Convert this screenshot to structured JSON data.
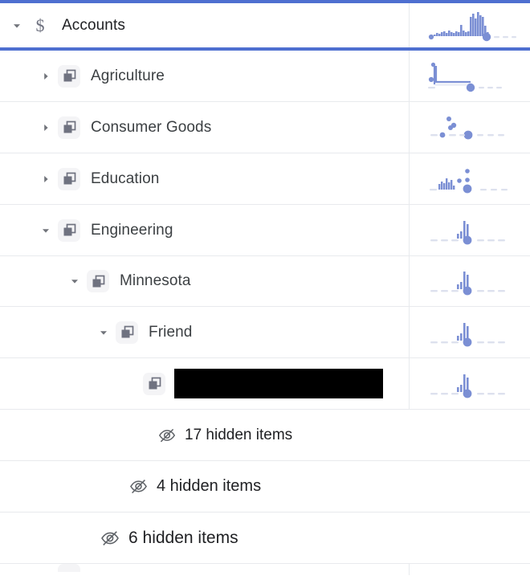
{
  "theme": {
    "accent_blue": "#4e6fd0",
    "spark_blue": "#7b8fd4",
    "spark_muted": "#dde1ee",
    "divider": "#e8eaed",
    "chip_bg": "#f4f4f6",
    "icon_gray": "#6f7280",
    "text": "#3c4043",
    "redaction": "#000000"
  },
  "header": {
    "title": "Accounts",
    "icon": "dollar-sign-icon",
    "twisty": "chevron-down-icon",
    "expanded": true
  },
  "rows": [
    {
      "label": "Agriculture",
      "icon": "layers-icon",
      "twisty": "chevron-right-icon",
      "expanded": false,
      "depth": 1,
      "type": "node"
    },
    {
      "label": "Consumer Goods",
      "icon": "layers-icon",
      "twisty": "chevron-right-icon",
      "expanded": false,
      "depth": 1,
      "type": "node"
    },
    {
      "label": "Education",
      "icon": "layers-icon",
      "twisty": "chevron-right-icon",
      "expanded": false,
      "depth": 1,
      "type": "node"
    },
    {
      "label": "Engineering",
      "icon": "layers-icon",
      "twisty": "chevron-down-icon",
      "expanded": true,
      "depth": 1,
      "type": "node"
    },
    {
      "label": "Minnesota",
      "icon": "layers-icon",
      "twisty": "chevron-down-icon",
      "expanded": true,
      "depth": 2,
      "type": "node"
    },
    {
      "label": "Friend",
      "icon": "layers-icon",
      "twisty": "chevron-down-icon",
      "expanded": true,
      "depth": 3,
      "type": "node"
    },
    {
      "label": "",
      "icon": "layers-icon",
      "twisty": "none",
      "expanded": false,
      "depth": 4,
      "type": "redacted"
    }
  ],
  "hidden_rows": [
    {
      "count": "17",
      "label": "17 hidden items",
      "icon": "eye-off-icon",
      "font_size": 19,
      "indent": 196
    },
    {
      "count": "4",
      "label": "4 hidden items",
      "icon": "eye-off-icon",
      "font_size": 20,
      "indent": 160
    },
    {
      "count": "6",
      "label": "6 hidden items",
      "icon": "eye-off-icon",
      "font_size": 21,
      "indent": 124
    }
  ],
  "chart_data": [
    {
      "type": "bar",
      "name": "Accounts",
      "title": "",
      "xlabel": "",
      "ylabel": "",
      "categories": [
        "1",
        "2",
        "3",
        "4",
        "5",
        "6",
        "7",
        "8",
        "9",
        "10",
        "11",
        "12",
        "13",
        "14",
        "15",
        "16",
        "17",
        "18",
        "19",
        "20",
        "21",
        "22",
        "23",
        "24",
        "25",
        "26",
        "27",
        "28"
      ],
      "values": [
        0,
        2,
        3,
        2,
        4,
        5,
        3,
        6,
        4,
        3,
        5,
        4,
        14,
        6,
        4,
        5,
        26,
        30,
        24,
        33,
        28,
        26,
        14,
        5,
        0,
        0,
        0,
        0
      ],
      "ylim": [
        0,
        34
      ],
      "dots": [
        {
          "x": 1,
          "size": "small"
        },
        {
          "x": 22,
          "size": "large"
        }
      ],
      "axis_dashes": [
        24,
        26,
        28
      ]
    },
    {
      "type": "line",
      "name": "Agriculture",
      "title": "",
      "xlabel": "",
      "ylabel": "",
      "x": [
        2,
        3,
        4,
        5,
        6,
        7,
        8,
        9,
        10,
        11,
        12,
        13,
        14,
        15,
        16
      ],
      "values": [
        26,
        5,
        5,
        5,
        5,
        5,
        5,
        5,
        5,
        5,
        5,
        5,
        5,
        5,
        5
      ],
      "ylim": [
        0,
        34
      ],
      "dots": [
        {
          "x": 1,
          "size": "small"
        },
        {
          "x": 15,
          "size": "large"
        }
      ],
      "axis_dashes": [
        1,
        18,
        21,
        24
      ]
    },
    {
      "type": "scatter",
      "name": "Consumer Goods",
      "title": "",
      "xlabel": "",
      "ylabel": "",
      "points": [
        {
          "x": 9,
          "y": 29
        },
        {
          "x": 10,
          "y": 16
        },
        {
          "x": 12,
          "y": 19
        }
      ],
      "ylim": [
        0,
        34
      ],
      "dots": [
        {
          "x": 5,
          "size": "small"
        },
        {
          "x": 15,
          "size": "large"
        }
      ],
      "axis_dashes": [
        1,
        3,
        8,
        11,
        18,
        21,
        24
      ]
    },
    {
      "type": "bar",
      "name": "Education",
      "title": "",
      "xlabel": "",
      "ylabel": "",
      "categories": [
        "1",
        "2",
        "3",
        "4",
        "5",
        "6",
        "7",
        "8",
        "9",
        "10",
        "11",
        "12",
        "13",
        "14",
        "15",
        "16"
      ],
      "values": [
        0,
        0,
        4,
        7,
        10,
        5,
        12,
        6,
        9,
        3,
        0,
        0,
        0,
        0,
        0,
        0
      ],
      "ylim": [
        0,
        34
      ],
      "points": [
        {
          "x": 12,
          "y": 10
        },
        {
          "x": 14,
          "y": 27
        },
        {
          "x": 14,
          "y": 12
        }
      ],
      "dots": [
        {
          "x": 14,
          "size": "large"
        }
      ],
      "axis_dashes": [
        1,
        19,
        22,
        25
      ]
    },
    {
      "type": "bar",
      "name": "Engineering",
      "title": "",
      "xlabel": "",
      "ylabel": "",
      "categories": [
        "1",
        "2",
        "3",
        "4",
        "5",
        "6",
        "7",
        "8",
        "9"
      ],
      "values": [
        0,
        0,
        0,
        6,
        9,
        22,
        18,
        0,
        0
      ],
      "ylim": [
        0,
        34
      ],
      "dots": [
        {
          "x": 14,
          "size": "large"
        }
      ],
      "axis_dashes": [
        2,
        5,
        8,
        11,
        17,
        20,
        23
      ]
    },
    {
      "type": "bar",
      "name": "Minnesota",
      "title": "",
      "xlabel": "",
      "ylabel": "",
      "categories": [
        "1",
        "2",
        "3",
        "4",
        "5",
        "6",
        "7",
        "8",
        "9"
      ],
      "values": [
        0,
        0,
        0,
        6,
        9,
        22,
        18,
        0,
        0
      ],
      "ylim": [
        0,
        34
      ],
      "dots": [
        {
          "x": 14,
          "size": "large"
        }
      ],
      "axis_dashes": [
        2,
        5,
        8,
        11,
        17,
        20,
        23
      ]
    },
    {
      "type": "bar",
      "name": "Friend",
      "title": "",
      "xlabel": "",
      "ylabel": "",
      "categories": [
        "1",
        "2",
        "3",
        "4",
        "5",
        "6",
        "7",
        "8",
        "9"
      ],
      "values": [
        0,
        0,
        0,
        6,
        9,
        22,
        18,
        0,
        0
      ],
      "ylim": [
        0,
        34
      ],
      "dots": [
        {
          "x": 14,
          "size": "large"
        }
      ],
      "axis_dashes": [
        2,
        5,
        8,
        11,
        17,
        20,
        23
      ]
    },
    {
      "type": "bar",
      "name": "Redacted",
      "title": "",
      "xlabel": "",
      "ylabel": "",
      "categories": [
        "1",
        "2",
        "3",
        "4",
        "5",
        "6",
        "7",
        "8",
        "9"
      ],
      "values": [
        0,
        0,
        0,
        6,
        9,
        22,
        18,
        0,
        0
      ],
      "ylim": [
        0,
        34
      ],
      "dots": [
        {
          "x": 14,
          "size": "large"
        }
      ],
      "axis_dashes": [
        2,
        5,
        8,
        11,
        17,
        20,
        23
      ]
    }
  ]
}
